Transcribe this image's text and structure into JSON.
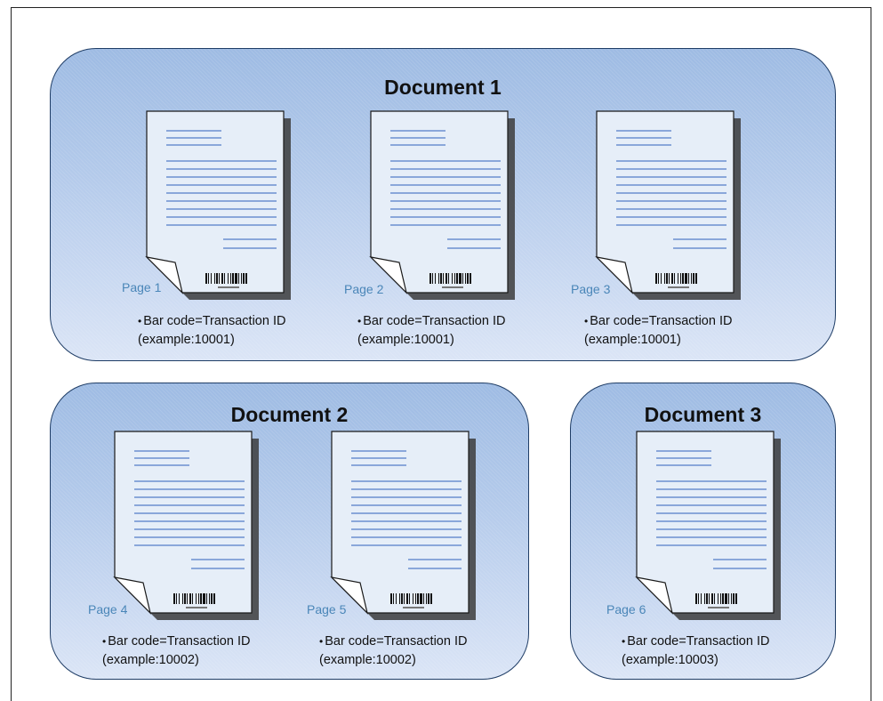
{
  "documents": [
    {
      "title": "Document 1",
      "pages": [
        {
          "label": "Page 1",
          "caption_line1": "Bar code=Transaction ID",
          "caption_line2": "(example:10001)"
        },
        {
          "label": "Page 2",
          "caption_line1": "Bar code=Transaction ID",
          "caption_line2": "(example:10001)"
        },
        {
          "label": "Page 3",
          "caption_line1": "Bar code=Transaction ID",
          "caption_line2": "(example:10001)"
        }
      ]
    },
    {
      "title": "Document 2",
      "pages": [
        {
          "label": "Page 4",
          "caption_line1": "Bar code=Transaction ID",
          "caption_line2": "(example:10002)"
        },
        {
          "label": "Page 5",
          "caption_line1": "Bar code=Transaction ID",
          "caption_line2": "(example:10002)"
        }
      ]
    },
    {
      "title": "Document 3",
      "pages": [
        {
          "label": "Page 6",
          "caption_line1": "Bar code=Transaction ID",
          "caption_line2": "(example:10003)"
        }
      ]
    }
  ],
  "colors": {
    "group_fill_top": "#9ebbe3",
    "group_fill_bottom": "#dbe5f6",
    "group_border": "#1f3d66",
    "page_fill": "#e6eef8",
    "text_line": "#6b8fd0",
    "page_label": "#4a86b8"
  },
  "icons": {
    "page": "document-page-icon",
    "barcode": "barcode-icon"
  }
}
